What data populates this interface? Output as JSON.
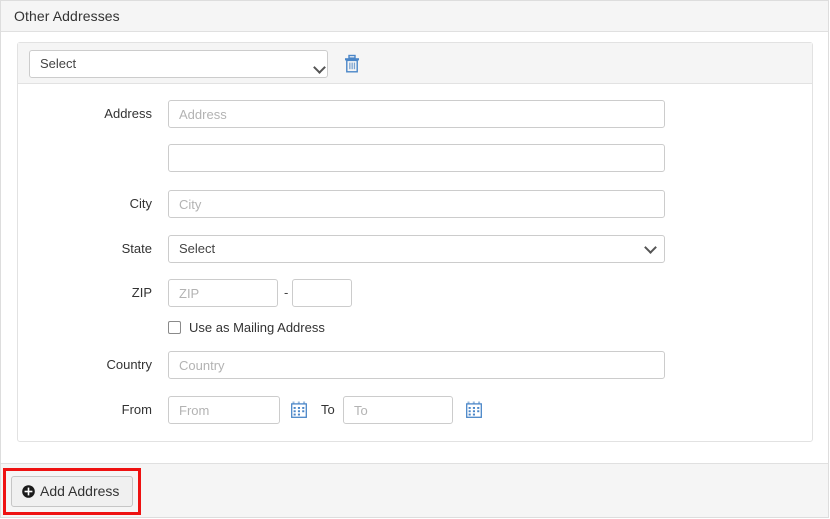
{
  "header": {
    "title": "Other Addresses"
  },
  "card": {
    "type_select": {
      "value": "Select",
      "icon": "chevron-down-icon"
    },
    "delete_icon": "trash-icon",
    "accent_colors": {
      "icon_blue": "#4a86c8",
      "highlight_red": "#ee1111",
      "panel_gray": "#f5f5f5",
      "border_gray": "#cccccc"
    },
    "fields": {
      "address_label": "Address",
      "address1_placeholder": "Address",
      "address1_value": "",
      "address2_placeholder": "",
      "address2_value": "",
      "city_label": "City",
      "city_placeholder": "City",
      "city_value": "",
      "state_label": "State",
      "state_value": "Select",
      "zip_label": "ZIP",
      "zip_placeholder": "ZIP",
      "zip_value": "",
      "zip_separator": "-",
      "zip_ext_placeholder": "",
      "zip_ext_value": "",
      "mailing_checkbox_label": "Use as Mailing Address",
      "mailing_checkbox_checked": false,
      "country_label": "Country",
      "country_placeholder": "Country",
      "country_value": "",
      "from_label": "From",
      "from_placeholder": "From",
      "from_value": "",
      "to_label": "To",
      "to_placeholder": "To",
      "to_value": "",
      "calendar_icon": "calendar-icon"
    }
  },
  "footer": {
    "add_button_label": "Add Address",
    "add_button_icon": "plus-circle-icon"
  }
}
